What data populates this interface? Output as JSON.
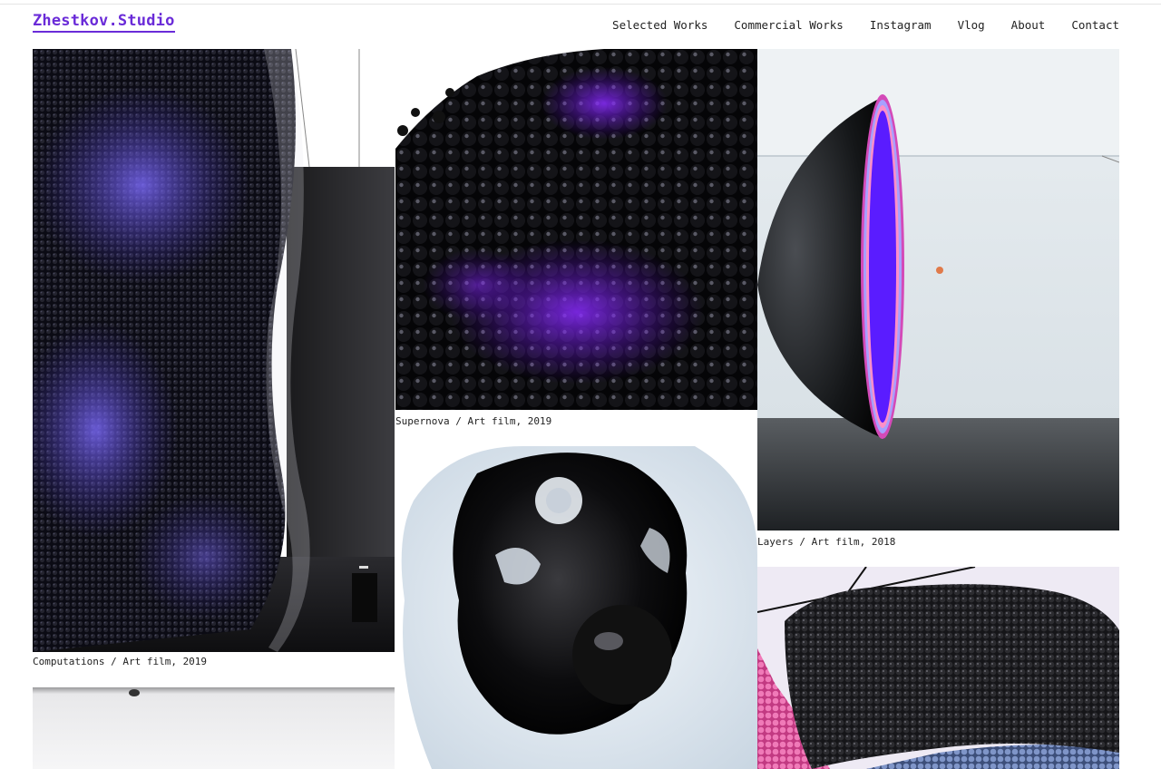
{
  "header": {
    "logo": "Zhestkov.Studio",
    "nav": [
      "Selected Works",
      "Commercial Works",
      "Instagram",
      "Vlog",
      "About",
      "Contact"
    ]
  },
  "works": {
    "computations": {
      "caption": "Computations / Art film, 2019"
    },
    "supernova": {
      "caption": "Supernova / Art film, 2019"
    },
    "layers": {
      "caption": "Layers / Art film, 2018"
    }
  },
  "colors": {
    "accent": "#6a2bd8",
    "violet_glow": "#5a1cff",
    "text": "#222222"
  }
}
